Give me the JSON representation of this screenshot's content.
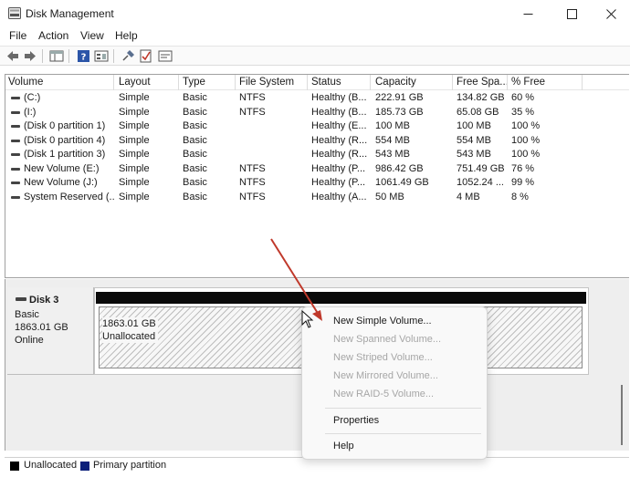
{
  "window": {
    "title": "Disk Management",
    "controls": {
      "minimize": "—",
      "maximize": "☐",
      "close": "✕"
    }
  },
  "menu": [
    "File",
    "Action",
    "View",
    "Help"
  ],
  "toolbar": {
    "icons": [
      "back-icon",
      "forward-icon",
      "properties-pane-icon",
      "help-icon",
      "console-tree-icon",
      "connect-icon",
      "check-icon",
      "settings-list-icon"
    ]
  },
  "table": {
    "columns": [
      "Volume",
      "Layout",
      "Type",
      "File System",
      "Status",
      "Capacity",
      "Free Spa...",
      "% Free"
    ],
    "rows": [
      [
        "(C:)",
        "Simple",
        "Basic",
        "NTFS",
        "Healthy (B...",
        "222.91 GB",
        "134.82 GB",
        "60 %"
      ],
      [
        "(I:)",
        "Simple",
        "Basic",
        "NTFS",
        "Healthy (B...",
        "185.73 GB",
        "65.08 GB",
        "35 %"
      ],
      [
        "(Disk 0 partition 1)",
        "Simple",
        "Basic",
        "",
        "Healthy (E...",
        "100 MB",
        "100 MB",
        "100 %"
      ],
      [
        "(Disk 0 partition 4)",
        "Simple",
        "Basic",
        "",
        "Healthy (R...",
        "554 MB",
        "554 MB",
        "100 %"
      ],
      [
        "(Disk 1 partition 3)",
        "Simple",
        "Basic",
        "",
        "Healthy (R...",
        "543 MB",
        "543 MB",
        "100 %"
      ],
      [
        "New Volume (E:)",
        "Simple",
        "Basic",
        "NTFS",
        "Healthy (P...",
        "986.42 GB",
        "751.49 GB",
        "76 %"
      ],
      [
        "New Volume (J:)",
        "Simple",
        "Basic",
        "NTFS",
        "Healthy (P...",
        "1061.49 GB",
        "1052.24 ...",
        "99 %"
      ],
      [
        "System Reserved (...",
        "Simple",
        "Basic",
        "NTFS",
        "Healthy (A...",
        "50 MB",
        "4 MB",
        "8 %"
      ]
    ]
  },
  "disk": {
    "name": "Disk 3",
    "type": "Basic",
    "size": "1863.01 GB",
    "state": "Online",
    "partition": {
      "size": "1863.01 GB",
      "label": "Unallocated"
    }
  },
  "legend": [
    {
      "label": "Unallocated",
      "color": "#000000"
    },
    {
      "label": "Primary partition",
      "color": "#0b1f7a"
    }
  ],
  "context_menu": {
    "items": [
      {
        "label": "New Simple Volume...",
        "enabled": true
      },
      {
        "label": "New Spanned Volume...",
        "enabled": false
      },
      {
        "label": "New Striped Volume...",
        "enabled": false
      },
      {
        "label": "New Mirrored Volume...",
        "enabled": false
      },
      {
        "label": "New RAID-5 Volume...",
        "enabled": false
      },
      {
        "label": "Properties",
        "enabled": true
      },
      {
        "label": "Help",
        "enabled": true
      }
    ]
  },
  "colors": {
    "annotation_arrow": "#c0392b",
    "unallocated_bar": "#0a0a0a"
  }
}
